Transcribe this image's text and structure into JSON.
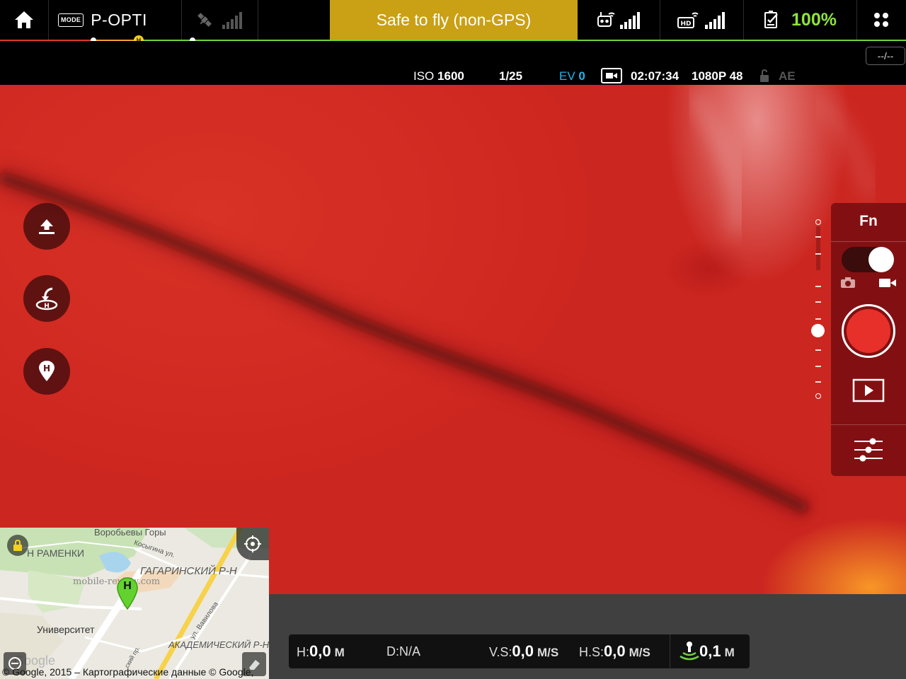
{
  "top_bar": {
    "mode_badge": "MODE",
    "flight_mode": "P-OPTI",
    "status_text": "Safe to fly (non-GPS)",
    "battery_percent": "100%",
    "status_color": "#caa014",
    "battery_color": "#8ee53a",
    "icons": [
      "home-icon",
      "satellite-icon",
      "gps-signal-icon",
      "remote-controller-icon",
      "rc-signal-icon",
      "hd-video-icon",
      "hd-signal-icon",
      "battery-icon",
      "menu-icon"
    ]
  },
  "camera_params": {
    "iso_label": "ISO",
    "iso_value": "1600",
    "shutter": "1/25",
    "ev_label": "EV",
    "ev_value": "0",
    "record_time": "02:07:34",
    "resolution": "1080P 48",
    "ae": "AE",
    "rate_indicator": "--/--"
  },
  "right_panel": {
    "fn_label": "Fn",
    "mode": "video"
  },
  "telemetry": {
    "h_label": "H:",
    "h_value": "0,0",
    "h_unit": "M",
    "d_label": "D:",
    "d_value": "N/A",
    "vs_label": "V.S:",
    "vs_value": "0,0",
    "vs_unit": "M/S",
    "hs_label": "H.S:",
    "hs_value": "0,0",
    "hs_unit": "M/S",
    "vps_value": "0,1",
    "vps_unit": "M"
  },
  "map": {
    "labels": {
      "vorobyovy": "Воробьевы Горы",
      "ramenki": "Н РАМЕНКИ",
      "kosygina": "Косыгина ул.",
      "gagarinsky": "ГАГАРИНСКИЙ Р-Н",
      "watermark": "mobile-review.com",
      "university": "Университет",
      "vavilova": "ул. Вавилова",
      "akademichesky": "АКАДЕМИЧЕСКИЙ Р-Н",
      "prospekt": "ский пр.",
      "google": "Google"
    },
    "copyright": "© Google, 2015 – Картографические данные © Google,",
    "home_marker": "H"
  }
}
